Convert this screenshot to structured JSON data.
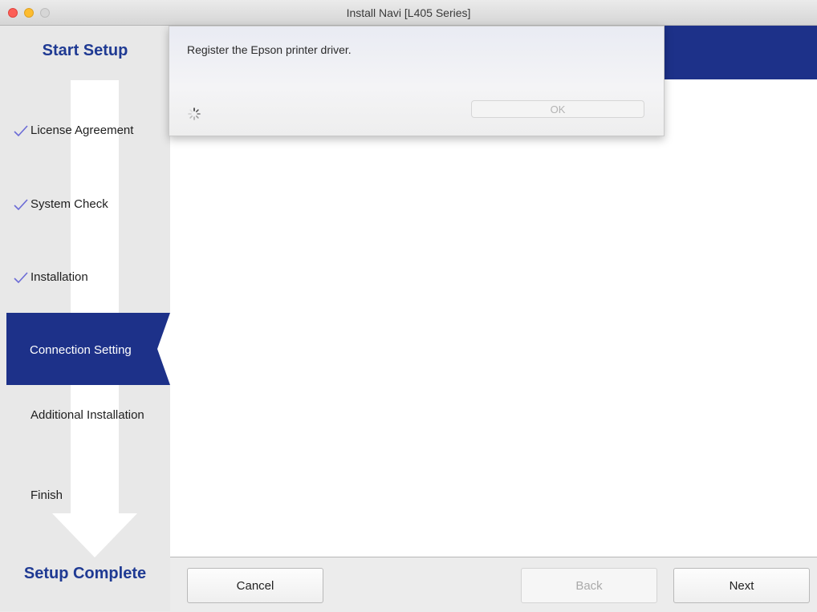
{
  "window": {
    "title": "Install Navi [L405 Series]"
  },
  "sidebar": {
    "top_header": "Start Setup",
    "bottom_header": "Setup Complete",
    "steps": [
      {
        "label": "License Agreement",
        "state": "done"
      },
      {
        "label": "System Check",
        "state": "done"
      },
      {
        "label": "Installation",
        "state": "done"
      },
      {
        "label": "Connection Setting",
        "state": "active"
      },
      {
        "label": "Additional Installation",
        "state": "pending"
      },
      {
        "label": "Finish",
        "state": "pending"
      }
    ]
  },
  "dialog": {
    "message": "Register the Epson printer driver.",
    "ok_label": "OK",
    "ok_enabled": false,
    "spinner_icon": "spinner-icon"
  },
  "footer": {
    "cancel_label": "Cancel",
    "back_label": "Back",
    "back_enabled": false,
    "next_label": "Next"
  },
  "colors": {
    "brand_blue": "#1d3189",
    "check_color": "#6b6bd6"
  }
}
